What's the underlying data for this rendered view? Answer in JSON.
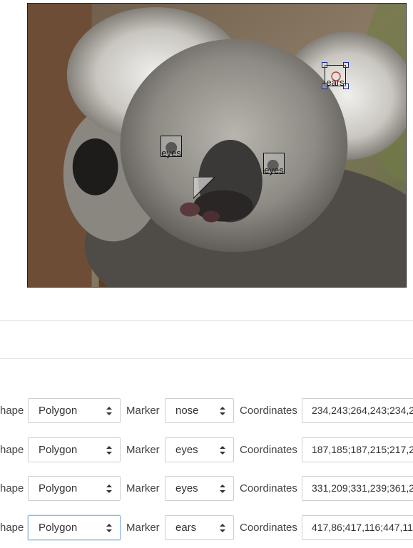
{
  "image": {
    "annotations": [
      {
        "marker": "eyes"
      },
      {
        "marker": "eyes"
      },
      {
        "marker": "ears"
      }
    ]
  },
  "form": {
    "shape_label": "hape",
    "marker_label": "Marker",
    "coordinates_label": "Coordinates",
    "rows": [
      {
        "shape": "Polygon",
        "marker": "nose",
        "coordinates": "234,243;264,243;234,2"
      },
      {
        "shape": "Polygon",
        "marker": "eyes",
        "coordinates": "187,185;187,215;217,2"
      },
      {
        "shape": "Polygon",
        "marker": "eyes",
        "coordinates": "331,209;331,239;361,2"
      },
      {
        "shape": "Polygon",
        "marker": "ears",
        "coordinates": "417,86;417,116;447,11"
      }
    ]
  }
}
